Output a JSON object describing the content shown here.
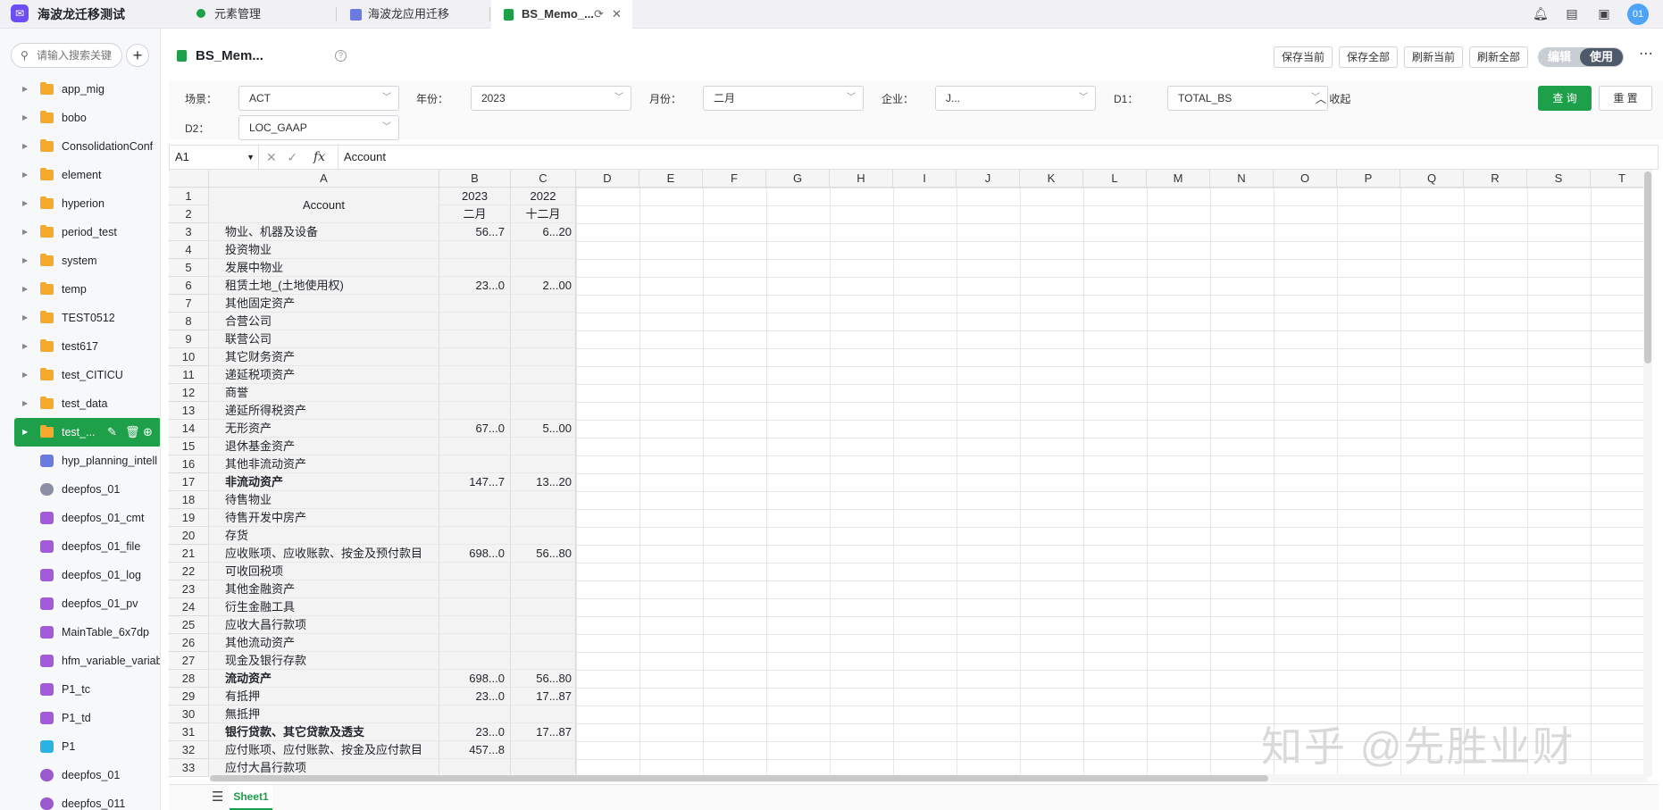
{
  "app": {
    "title": "海波龙迁移测试",
    "logo_icon": "mail-icon"
  },
  "tabs": [
    {
      "label": "元素管理",
      "icon": "tree-icon",
      "active": false
    },
    {
      "label": "海波龙应用迁移",
      "icon": "app-icon",
      "active": false
    },
    {
      "label": "BS_Memo_...",
      "icon": "doc-icon",
      "active": true
    }
  ],
  "header": {
    "avatar": "01"
  },
  "sidebar": {
    "search_placeholder": "请输入搜索关键",
    "items": [
      {
        "label": "app_mig",
        "type": "folder"
      },
      {
        "label": "bobo",
        "type": "folder"
      },
      {
        "label": "ConsolidationConf",
        "type": "folder"
      },
      {
        "label": "element",
        "type": "folder"
      },
      {
        "label": "hyperion",
        "type": "folder"
      },
      {
        "label": "period_test",
        "type": "folder"
      },
      {
        "label": "system",
        "type": "folder"
      },
      {
        "label": "temp",
        "type": "folder"
      },
      {
        "label": "TEST0512",
        "type": "folder"
      },
      {
        "label": "test617",
        "type": "folder"
      },
      {
        "label": "test_CITICU",
        "type": "folder"
      },
      {
        "label": "test_data",
        "type": "folder"
      },
      {
        "label": "test_...",
        "type": "folder-selected"
      },
      {
        "label": "hyp_planning_intell",
        "type": "table"
      },
      {
        "label": "deepfos_01",
        "type": "database"
      },
      {
        "label": "deepfos_01_cmt",
        "type": "datatable"
      },
      {
        "label": "deepfos_01_file",
        "type": "datatable"
      },
      {
        "label": "deepfos_01_log",
        "type": "datatable"
      },
      {
        "label": "deepfos_01_pv",
        "type": "datatable"
      },
      {
        "label": "MainTable_6x7dp",
        "type": "datatable"
      },
      {
        "label": "hfm_variable_variab",
        "type": "datatable"
      },
      {
        "label": "P1_tc",
        "type": "datatable"
      },
      {
        "label": "P1_td",
        "type": "datatable"
      },
      {
        "label": "P1",
        "type": "cube"
      },
      {
        "label": "deepfos_01",
        "type": "python"
      },
      {
        "label": "deepfos_011",
        "type": "python"
      }
    ]
  },
  "doc": {
    "title": "BS_Mem...",
    "buttons": [
      "保存当前",
      "保存全部",
      "刷新当前",
      "刷新全部"
    ],
    "toggle_edit": "编辑",
    "toggle_use": "使用"
  },
  "filters": {
    "scene_label": "场景：",
    "scene_value": "ACT",
    "year_label": "年份：",
    "year_value": "2023",
    "month_label": "月份：",
    "month_value": "二月",
    "entity_label": "企业：",
    "entity_value": "J...",
    "d1_label": "D1：",
    "d1_value": "TOTAL_BS",
    "d2_label": "D2：",
    "d2_value": "LOC_GAAP",
    "collapse": "收起",
    "query": "查 询",
    "reset": "重 置"
  },
  "formula_bar": {
    "cell": "A1",
    "fx": "fx",
    "value": "Account"
  },
  "sheet": {
    "columns": [
      "A",
      "B",
      "C",
      "D",
      "E",
      "F",
      "G",
      "H",
      "I",
      "J",
      "K",
      "L",
      "M",
      "N",
      "O",
      "P",
      "Q",
      "R",
      "S",
      "T"
    ],
    "header_label": "Account",
    "year_b": "2023",
    "year_c": "2022",
    "period_b": "二月",
    "period_c": "十二月",
    "rows": [
      {
        "n": "1",
        "a": "",
        "b": "",
        "c": ""
      },
      {
        "n": "2",
        "a": "",
        "b": "",
        "c": ""
      },
      {
        "n": "3",
        "a": "物业、机器及设备",
        "b": "56...7",
        "c": "6...20"
      },
      {
        "n": "4",
        "a": "投资物业",
        "b": "",
        "c": ""
      },
      {
        "n": "5",
        "a": "发展中物业",
        "b": "",
        "c": ""
      },
      {
        "n": "6",
        "a": "租赁土地_(土地使用权)",
        "b": "23...0",
        "c": "2...00"
      },
      {
        "n": "7",
        "a": "其他固定资产",
        "b": "",
        "c": ""
      },
      {
        "n": "8",
        "a": "合营公司",
        "b": "",
        "c": ""
      },
      {
        "n": "9",
        "a": "联营公司",
        "b": "",
        "c": ""
      },
      {
        "n": "10",
        "a": "其它财务资产",
        "b": "",
        "c": ""
      },
      {
        "n": "11",
        "a": "递延税项资产",
        "b": "",
        "c": ""
      },
      {
        "n": "12",
        "a": "商誉",
        "b": "",
        "c": ""
      },
      {
        "n": "13",
        "a": "递延所得税资产",
        "b": "",
        "c": ""
      },
      {
        "n": "14",
        "a": "无形资产",
        "b": "67...0",
        "c": "5...00"
      },
      {
        "n": "15",
        "a": "退休基金资产",
        "b": "",
        "c": ""
      },
      {
        "n": "16",
        "a": "其他非流动资产",
        "b": "",
        "c": ""
      },
      {
        "n": "17",
        "a": "非流动资产",
        "b": "147...7",
        "c": "13...20",
        "bold": true
      },
      {
        "n": "18",
        "a": "待售物业",
        "b": "",
        "c": ""
      },
      {
        "n": "19",
        "a": "待售开发中房产",
        "b": "",
        "c": ""
      },
      {
        "n": "20",
        "a": "存货",
        "b": "",
        "c": ""
      },
      {
        "n": "21",
        "a": "应收账项、应收账款、按金及预付款目",
        "b": "698...0",
        "c": "56...80"
      },
      {
        "n": "22",
        "a": "可收回税项",
        "b": "",
        "c": ""
      },
      {
        "n": "23",
        "a": "其他金融资产",
        "b": "",
        "c": ""
      },
      {
        "n": "24",
        "a": "衍生金融工具",
        "b": "",
        "c": ""
      },
      {
        "n": "25",
        "a": "应收大昌行款项",
        "b": "",
        "c": ""
      },
      {
        "n": "26",
        "a": "其他流动资产",
        "b": "",
        "c": ""
      },
      {
        "n": "27",
        "a": "现金及银行存款",
        "b": "",
        "c": ""
      },
      {
        "n": "28",
        "a": "流动资产",
        "b": "698...0",
        "c": "56...80",
        "bold": true
      },
      {
        "n": "29",
        "a": "有抵押",
        "b": "23...0",
        "c": "17...87"
      },
      {
        "n": "30",
        "a": "無抵押",
        "b": "",
        "c": ""
      },
      {
        "n": "31",
        "a": "银行贷款、其它贷款及透支",
        "b": "23...0",
        "c": "17...87",
        "bold": true
      },
      {
        "n": "32",
        "a": "应付账项、应付账款、按金及应付款目",
        "b": "457...8",
        "c": ""
      },
      {
        "n": "33",
        "a": "应付大昌行款项",
        "b": "",
        "c": ""
      }
    ],
    "tab_label": "Sheet1"
  },
  "watermark": "知乎 @先胜业财",
  "colors": {
    "brand_green": "#1da049",
    "accent_purple": "#6c4ef5",
    "folder_orange": "#f7a92b"
  }
}
